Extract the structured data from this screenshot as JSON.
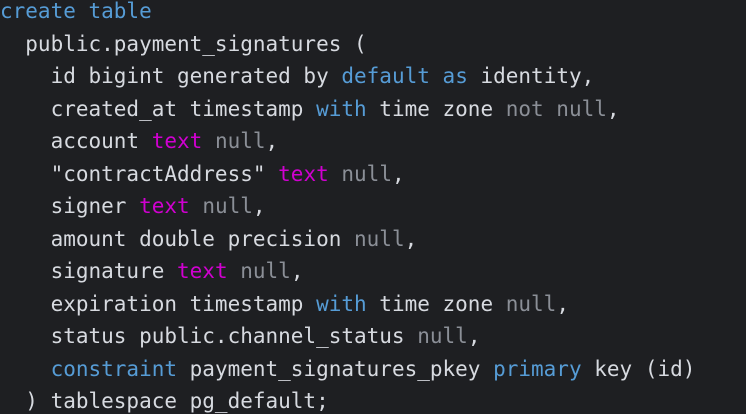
{
  "lines": [
    {
      "tokens": [
        {
          "t": "create table",
          "c": "kw"
        }
      ]
    },
    {
      "tokens": [
        {
          "t": "  public.payment_signatures (",
          "c": "plain"
        }
      ]
    },
    {
      "tokens": [
        {
          "t": "    id bigint generated by ",
          "c": "plain"
        },
        {
          "t": "default",
          "c": "kw"
        },
        {
          "t": " ",
          "c": "plain"
        },
        {
          "t": "as",
          "c": "kw"
        },
        {
          "t": " identity,",
          "c": "plain"
        }
      ]
    },
    {
      "tokens": [
        {
          "t": "    created_at timestamp ",
          "c": "plain"
        },
        {
          "t": "with",
          "c": "kw"
        },
        {
          "t": " time zone ",
          "c": "plain"
        },
        {
          "t": "not null",
          "c": "muted"
        },
        {
          "t": ",",
          "c": "plain"
        }
      ]
    },
    {
      "tokens": [
        {
          "t": "    account ",
          "c": "plain"
        },
        {
          "t": "text",
          "c": "type"
        },
        {
          "t": " ",
          "c": "plain"
        },
        {
          "t": "null",
          "c": "muted"
        },
        {
          "t": ",",
          "c": "plain"
        }
      ]
    },
    {
      "tokens": [
        {
          "t": "    \"contractAddress\" ",
          "c": "plain"
        },
        {
          "t": "text",
          "c": "type"
        },
        {
          "t": " ",
          "c": "plain"
        },
        {
          "t": "null",
          "c": "muted"
        },
        {
          "t": ",",
          "c": "plain"
        }
      ]
    },
    {
      "tokens": [
        {
          "t": "    signer ",
          "c": "plain"
        },
        {
          "t": "text",
          "c": "type"
        },
        {
          "t": " ",
          "c": "plain"
        },
        {
          "t": "null",
          "c": "muted"
        },
        {
          "t": ",",
          "c": "plain"
        }
      ]
    },
    {
      "tokens": [
        {
          "t": "    amount double precision ",
          "c": "plain"
        },
        {
          "t": "null",
          "c": "muted"
        },
        {
          "t": ",",
          "c": "plain"
        }
      ]
    },
    {
      "tokens": [
        {
          "t": "    signature ",
          "c": "plain"
        },
        {
          "t": "text",
          "c": "type"
        },
        {
          "t": " ",
          "c": "plain"
        },
        {
          "t": "null",
          "c": "muted"
        },
        {
          "t": ",",
          "c": "plain"
        }
      ]
    },
    {
      "tokens": [
        {
          "t": "    expiration timestamp ",
          "c": "plain"
        },
        {
          "t": "with",
          "c": "kw"
        },
        {
          "t": " time zone ",
          "c": "plain"
        },
        {
          "t": "null",
          "c": "muted"
        },
        {
          "t": ",",
          "c": "plain"
        }
      ]
    },
    {
      "tokens": [
        {
          "t": "    status public.channel_status ",
          "c": "plain"
        },
        {
          "t": "null",
          "c": "muted"
        },
        {
          "t": ",",
          "c": "plain"
        }
      ]
    },
    {
      "tokens": [
        {
          "t": "    ",
          "c": "plain"
        },
        {
          "t": "constraint",
          "c": "kw"
        },
        {
          "t": " payment_signatures_pkey ",
          "c": "plain"
        },
        {
          "t": "primary",
          "c": "kw"
        },
        {
          "t": " key (id)",
          "c": "plain"
        }
      ]
    },
    {
      "tokens": [
        {
          "t": "  ) tablespace pg_default;",
          "c": "plain"
        }
      ]
    }
  ],
  "colors": {
    "background": "#1e1f22",
    "keyword": "#569cd6",
    "type": "#d000d0",
    "muted": "#8b8f97",
    "plain": "#d7dae0"
  }
}
